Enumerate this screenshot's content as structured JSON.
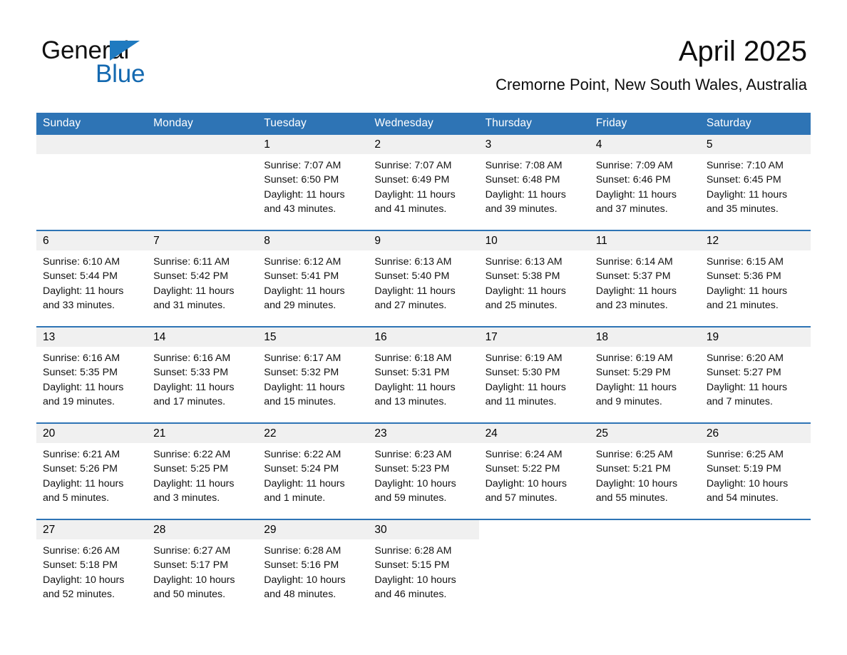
{
  "brand": {
    "name_part1": "General",
    "name_part2": "Blue",
    "accent_color": "#1469b0",
    "triangle_color": "#1f7ac0"
  },
  "header": {
    "month_title": "April 2025",
    "location": "Cremorne Point, New South Wales, Australia",
    "header_bg_color": "#2e74b5",
    "daynum_band_color": "#f0f0f0"
  },
  "weekday_headers": [
    "Sunday",
    "Monday",
    "Tuesday",
    "Wednesday",
    "Thursday",
    "Friday",
    "Saturday"
  ],
  "weeks": [
    [
      {
        "day": "",
        "lines": [
          "",
          "",
          "",
          ""
        ],
        "empty": true
      },
      {
        "day": "",
        "lines": [
          "",
          "",
          "",
          ""
        ],
        "empty": true
      },
      {
        "day": "1",
        "lines": [
          "Sunrise: 7:07 AM",
          "Sunset: 6:50 PM",
          "Daylight: 11 hours",
          "and 43 minutes."
        ]
      },
      {
        "day": "2",
        "lines": [
          "Sunrise: 7:07 AM",
          "Sunset: 6:49 PM",
          "Daylight: 11 hours",
          "and 41 minutes."
        ]
      },
      {
        "day": "3",
        "lines": [
          "Sunrise: 7:08 AM",
          "Sunset: 6:48 PM",
          "Daylight: 11 hours",
          "and 39 minutes."
        ]
      },
      {
        "day": "4",
        "lines": [
          "Sunrise: 7:09 AM",
          "Sunset: 6:46 PM",
          "Daylight: 11 hours",
          "and 37 minutes."
        ]
      },
      {
        "day": "5",
        "lines": [
          "Sunrise: 7:10 AM",
          "Sunset: 6:45 PM",
          "Daylight: 11 hours",
          "and 35 minutes."
        ]
      }
    ],
    [
      {
        "day": "6",
        "lines": [
          "Sunrise: 6:10 AM",
          "Sunset: 5:44 PM",
          "Daylight: 11 hours",
          "and 33 minutes."
        ]
      },
      {
        "day": "7",
        "lines": [
          "Sunrise: 6:11 AM",
          "Sunset: 5:42 PM",
          "Daylight: 11 hours",
          "and 31 minutes."
        ]
      },
      {
        "day": "8",
        "lines": [
          "Sunrise: 6:12 AM",
          "Sunset: 5:41 PM",
          "Daylight: 11 hours",
          "and 29 minutes."
        ]
      },
      {
        "day": "9",
        "lines": [
          "Sunrise: 6:13 AM",
          "Sunset: 5:40 PM",
          "Daylight: 11 hours",
          "and 27 minutes."
        ]
      },
      {
        "day": "10",
        "lines": [
          "Sunrise: 6:13 AM",
          "Sunset: 5:38 PM",
          "Daylight: 11 hours",
          "and 25 minutes."
        ]
      },
      {
        "day": "11",
        "lines": [
          "Sunrise: 6:14 AM",
          "Sunset: 5:37 PM",
          "Daylight: 11 hours",
          "and 23 minutes."
        ]
      },
      {
        "day": "12",
        "lines": [
          "Sunrise: 6:15 AM",
          "Sunset: 5:36 PM",
          "Daylight: 11 hours",
          "and 21 minutes."
        ]
      }
    ],
    [
      {
        "day": "13",
        "lines": [
          "Sunrise: 6:16 AM",
          "Sunset: 5:35 PM",
          "Daylight: 11 hours",
          "and 19 minutes."
        ]
      },
      {
        "day": "14",
        "lines": [
          "Sunrise: 6:16 AM",
          "Sunset: 5:33 PM",
          "Daylight: 11 hours",
          "and 17 minutes."
        ]
      },
      {
        "day": "15",
        "lines": [
          "Sunrise: 6:17 AM",
          "Sunset: 5:32 PM",
          "Daylight: 11 hours",
          "and 15 minutes."
        ]
      },
      {
        "day": "16",
        "lines": [
          "Sunrise: 6:18 AM",
          "Sunset: 5:31 PM",
          "Daylight: 11 hours",
          "and 13 minutes."
        ]
      },
      {
        "day": "17",
        "lines": [
          "Sunrise: 6:19 AM",
          "Sunset: 5:30 PM",
          "Daylight: 11 hours",
          "and 11 minutes."
        ]
      },
      {
        "day": "18",
        "lines": [
          "Sunrise: 6:19 AM",
          "Sunset: 5:29 PM",
          "Daylight: 11 hours",
          "and 9 minutes."
        ]
      },
      {
        "day": "19",
        "lines": [
          "Sunrise: 6:20 AM",
          "Sunset: 5:27 PM",
          "Daylight: 11 hours",
          "and 7 minutes."
        ]
      }
    ],
    [
      {
        "day": "20",
        "lines": [
          "Sunrise: 6:21 AM",
          "Sunset: 5:26 PM",
          "Daylight: 11 hours",
          "and 5 minutes."
        ]
      },
      {
        "day": "21",
        "lines": [
          "Sunrise: 6:22 AM",
          "Sunset: 5:25 PM",
          "Daylight: 11 hours",
          "and 3 minutes."
        ]
      },
      {
        "day": "22",
        "lines": [
          "Sunrise: 6:22 AM",
          "Sunset: 5:24 PM",
          "Daylight: 11 hours",
          "and 1 minute."
        ]
      },
      {
        "day": "23",
        "lines": [
          "Sunrise: 6:23 AM",
          "Sunset: 5:23 PM",
          "Daylight: 10 hours",
          "and 59 minutes."
        ]
      },
      {
        "day": "24",
        "lines": [
          "Sunrise: 6:24 AM",
          "Sunset: 5:22 PM",
          "Daylight: 10 hours",
          "and 57 minutes."
        ]
      },
      {
        "day": "25",
        "lines": [
          "Sunrise: 6:25 AM",
          "Sunset: 5:21 PM",
          "Daylight: 10 hours",
          "and 55 minutes."
        ]
      },
      {
        "day": "26",
        "lines": [
          "Sunrise: 6:25 AM",
          "Sunset: 5:19 PM",
          "Daylight: 10 hours",
          "and 54 minutes."
        ]
      }
    ],
    [
      {
        "day": "27",
        "lines": [
          "Sunrise: 6:26 AM",
          "Sunset: 5:18 PM",
          "Daylight: 10 hours",
          "and 52 minutes."
        ]
      },
      {
        "day": "28",
        "lines": [
          "Sunrise: 6:27 AM",
          "Sunset: 5:17 PM",
          "Daylight: 10 hours",
          "and 50 minutes."
        ]
      },
      {
        "day": "29",
        "lines": [
          "Sunrise: 6:28 AM",
          "Sunset: 5:16 PM",
          "Daylight: 10 hours",
          "and 48 minutes."
        ]
      },
      {
        "day": "30",
        "lines": [
          "Sunrise: 6:28 AM",
          "Sunset: 5:15 PM",
          "Daylight: 10 hours",
          "and 46 minutes."
        ]
      },
      {
        "day": "",
        "lines": [
          "",
          "",
          "",
          ""
        ],
        "nodata": true
      },
      {
        "day": "",
        "lines": [
          "",
          "",
          "",
          ""
        ],
        "nodata": true
      },
      {
        "day": "",
        "lines": [
          "",
          "",
          "",
          ""
        ],
        "nodata": true
      }
    ]
  ]
}
